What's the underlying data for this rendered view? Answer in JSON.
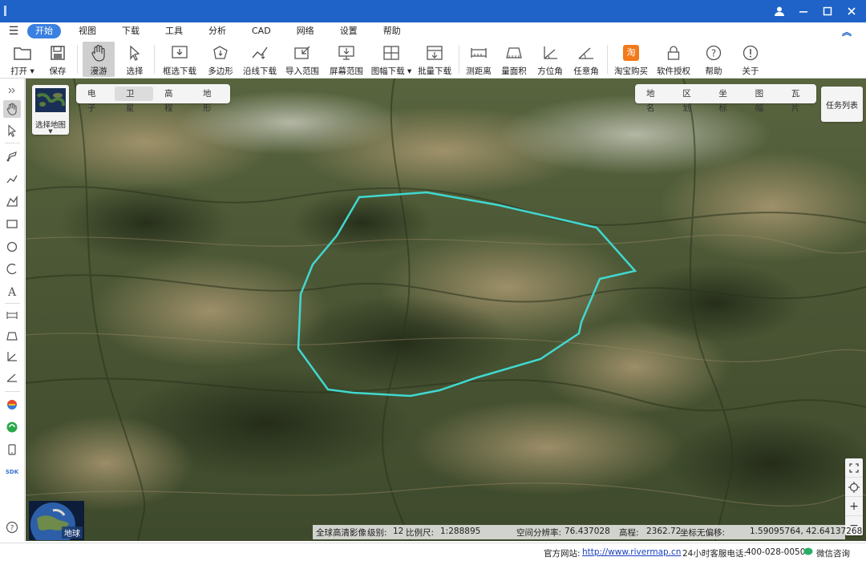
{
  "window": {
    "title": "",
    "controls": [
      "user-icon",
      "minimize-icon",
      "maximize-icon",
      "close-icon"
    ]
  },
  "menu": {
    "items": [
      "开始",
      "视图",
      "下载",
      "工具",
      "分析",
      "CAD",
      "网络",
      "设置",
      "帮助"
    ],
    "active": "开始"
  },
  "toolbar": {
    "items": [
      {
        "label": "打开",
        "icon": "folder-icon",
        "dropdown": true
      },
      {
        "label": "保存",
        "icon": "save-icon"
      },
      {
        "label": "漫游",
        "icon": "hand-icon",
        "active": true
      },
      {
        "label": "选择",
        "icon": "pointer-icon"
      },
      {
        "label": "框选下载",
        "icon": "box-download-icon"
      },
      {
        "label": "多边形",
        "icon": "polygon-download-icon"
      },
      {
        "label": "沿线下载",
        "icon": "line-download-icon"
      },
      {
        "label": "导入范围",
        "icon": "import-range-icon"
      },
      {
        "label": "屏幕范围",
        "icon": "screen-range-icon"
      },
      {
        "label": "图幅下载",
        "icon": "sheet-download-icon",
        "dropdown": true
      },
      {
        "label": "批量下载",
        "icon": "batch-download-icon"
      },
      {
        "label": "测距离",
        "icon": "ruler-icon"
      },
      {
        "label": "量面积",
        "icon": "area-icon"
      },
      {
        "label": "方位角",
        "icon": "azimuth-icon"
      },
      {
        "label": "任意角",
        "icon": "angle-icon"
      },
      {
        "label": "淘宝购买",
        "icon": "taobao-icon"
      },
      {
        "label": "软件授权",
        "icon": "lock-icon"
      },
      {
        "label": "帮助",
        "icon": "help-icon"
      },
      {
        "label": "关于",
        "icon": "info-icon"
      }
    ]
  },
  "map": {
    "layer_tabs": [
      "电子",
      "卫星",
      "高程",
      "地形"
    ],
    "active_layer": "卫星",
    "overlay_tabs": [
      "地名",
      "区划",
      "坐标",
      "图幅",
      "瓦片"
    ],
    "select_map_label": "选择地图",
    "task_list_label": "任务列表",
    "globe_label": "地球",
    "polygon_color": "#40d8d0"
  },
  "status": {
    "source": "全球高清影像",
    "level_label": "级别:",
    "level": "12",
    "scale_label": "比例尺:",
    "scale": "1:288895",
    "resolution_label": "空间分辨率:",
    "resolution": "76.437028",
    "elevation_label": "高程:",
    "elevation": "2362.72",
    "coord_label": "坐标无偏移:",
    "coords": "1.59095764, 42.64137268"
  },
  "footer": {
    "site_label": "官方网站:",
    "site_url": "http://www.rivermap.cn",
    "hotline_label": "24小时客服电话:",
    "hotline": "400-028-0050",
    "wechat": "微信咨询"
  }
}
